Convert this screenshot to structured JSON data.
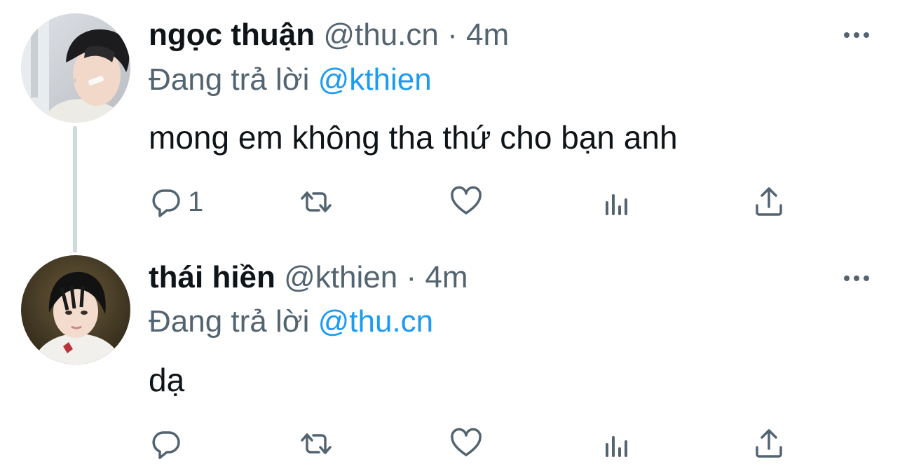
{
  "tweets": [
    {
      "name": "ngọc thuận",
      "handle": "@thu.cn",
      "separator": "·",
      "time": "4m",
      "replying_prefix": "Đang trả lời ",
      "replying_to": "@kthien",
      "text": "mong em không tha thứ cho bạn anh",
      "reply_count": "1"
    },
    {
      "name": "thái hiền",
      "handle": "@kthien",
      "separator": "·",
      "time": "4m",
      "replying_prefix": "Đang trả lời ",
      "replying_to": "@thu.cn",
      "text": "dạ",
      "reply_count": ""
    }
  ],
  "icons": {
    "reply": "reply-icon",
    "retweet": "retweet-icon",
    "like": "heart-icon",
    "views": "views-icon",
    "share": "share-icon",
    "more": "more-icon"
  },
  "colors": {
    "text": "#0f1419",
    "secondary": "#536471",
    "mention": "#1d9bf0",
    "thread_line": "#cfd9de"
  }
}
